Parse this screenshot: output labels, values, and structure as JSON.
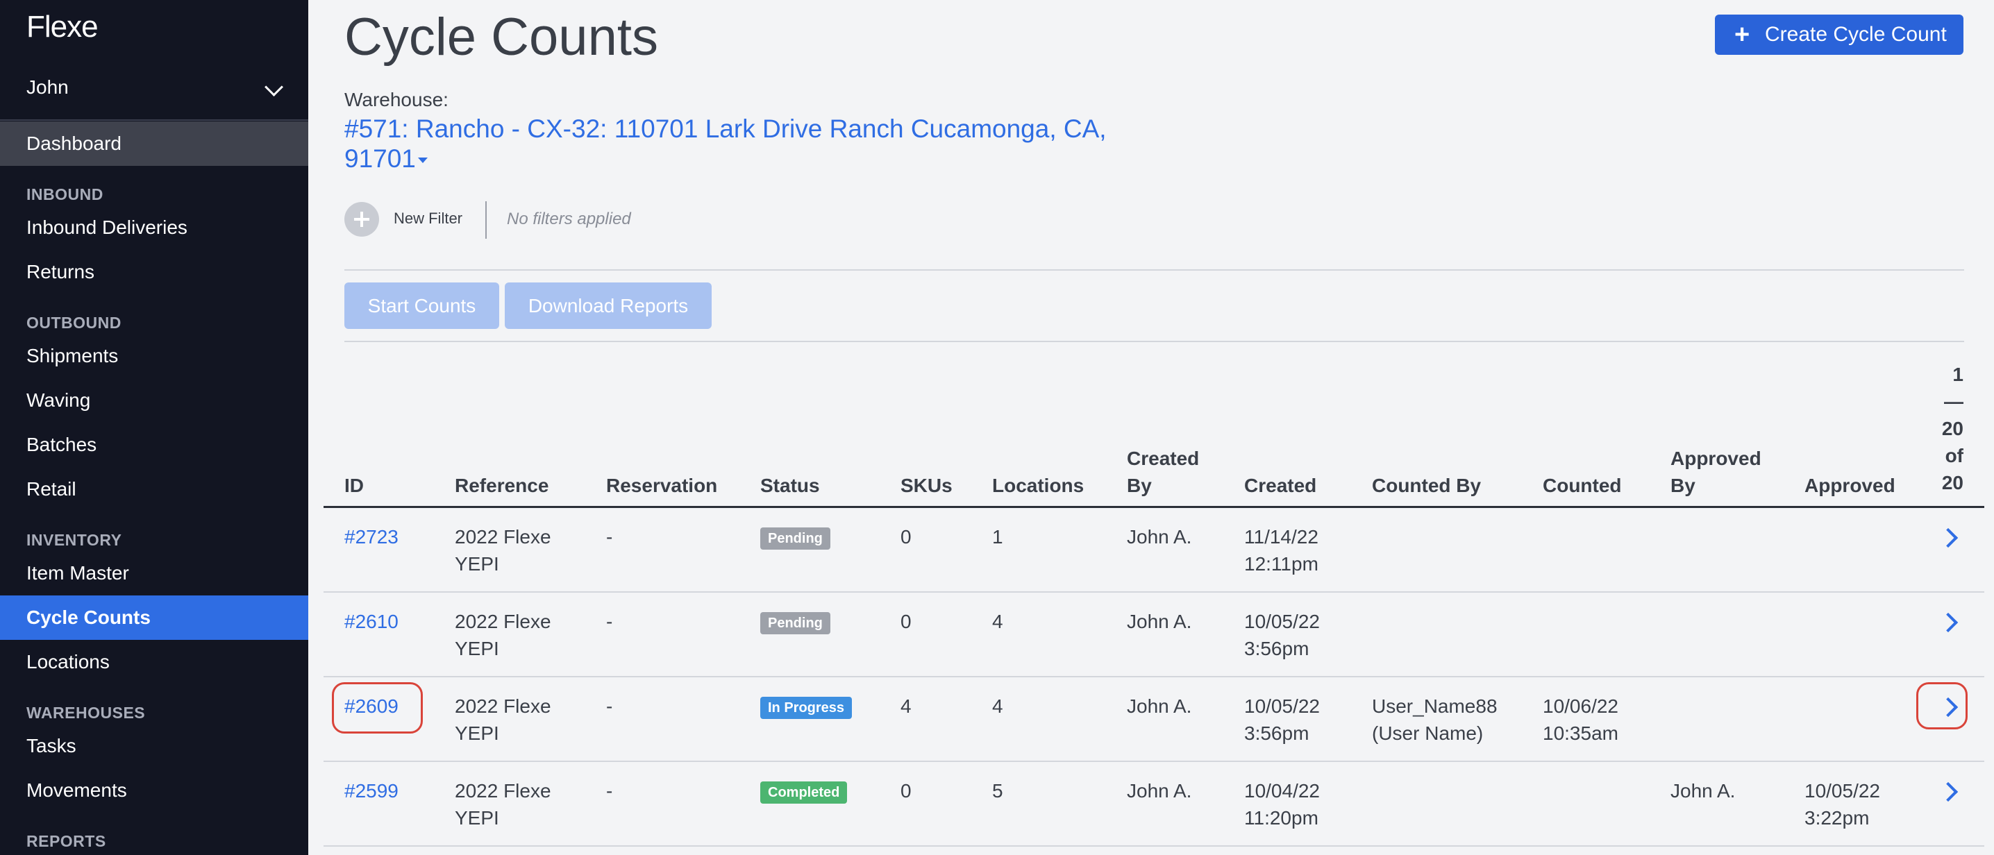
{
  "app": {
    "logo": "Flexe",
    "user": "John"
  },
  "sidebar": {
    "dashboard": "Dashboard",
    "sections": [
      {
        "title": "INBOUND",
        "items": [
          "Inbound Deliveries",
          "Returns"
        ]
      },
      {
        "title": "OUTBOUND",
        "items": [
          "Shipments",
          "Waving",
          "Batches",
          "Retail"
        ]
      },
      {
        "title": "INVENTORY",
        "items": [
          "Item Master",
          "Cycle Counts",
          "Locations"
        ]
      },
      {
        "title": "WAREHOUSES",
        "items": [
          "Tasks",
          "Movements"
        ]
      },
      {
        "title": "REPORTS",
        "items": []
      }
    ],
    "active_item": "Cycle Counts"
  },
  "page": {
    "title": "Cycle Counts",
    "create_button": "Create Cycle Count",
    "warehouse_label": "Warehouse:",
    "warehouse_value": "#571: Rancho - CX-32: 110701 Lark Drive Ranch Cucamonga, CA, 91701",
    "new_filter": "New Filter",
    "no_filters": "No filters applied",
    "start_counts": "Start Counts",
    "download_reports": "Download Reports"
  },
  "table": {
    "headers": {
      "id": "ID",
      "reference": "Reference",
      "reservation": "Reservation",
      "status": "Status",
      "skus": "SKUs",
      "locations": "Locations",
      "created_by_1": "Created",
      "created_by_2": "By",
      "created": "Created",
      "counted_by": "Counted By",
      "counted": "Counted",
      "approved_by_1": "Approved",
      "approved_by_2": "By",
      "approved": "Approved"
    },
    "pagination": {
      "start": "1",
      "dash": "—",
      "end": "20",
      "of": "of",
      "total": "20"
    },
    "rows": [
      {
        "id": "#2723",
        "ref1": "2022 Flexe",
        "ref2": "YEPI",
        "reservation": "-",
        "status": "Pending",
        "skus": "0",
        "locations": "1",
        "created_by": "John A.",
        "created1": "11/14/22",
        "created2": "12:11pm",
        "counted_by1": "",
        "counted_by2": "",
        "counted1": "",
        "counted2": "",
        "approved_by": "",
        "approved1": "",
        "approved2": ""
      },
      {
        "id": "#2610",
        "ref1": "2022 Flexe",
        "ref2": "YEPI",
        "reservation": "-",
        "status": "Pending",
        "skus": "0",
        "locations": "4",
        "created_by": "John A.",
        "created1": "10/05/22",
        "created2": "3:56pm",
        "counted_by1": "",
        "counted_by2": "",
        "counted1": "",
        "counted2": "",
        "approved_by": "",
        "approved1": "",
        "approved2": ""
      },
      {
        "id": "#2609",
        "ref1": "2022 Flexe",
        "ref2": "YEPI",
        "reservation": "-",
        "status": "In Progress",
        "skus": "4",
        "locations": "4",
        "created_by": "John A.",
        "created1": "10/05/22",
        "created2": "3:56pm",
        "counted_by1": "User_Name88",
        "counted_by2": "(User Name)",
        "counted1": "10/06/22",
        "counted2": "10:35am",
        "approved_by": "",
        "approved1": "",
        "approved2": ""
      },
      {
        "id": "#2599",
        "ref1": "2022 Flexe",
        "ref2": "YEPI",
        "reservation": "-",
        "status": "Completed",
        "skus": "0",
        "locations": "5",
        "created_by": "John A.",
        "created1": "10/04/22",
        "created2": "11:20pm",
        "counted_by1": "",
        "counted_by2": "",
        "counted1": "",
        "counted2": "",
        "approved_by": "John A.",
        "approved1": "10/05/22",
        "approved2": "3:22pm"
      }
    ]
  },
  "colors": {
    "accent": "#2a63d9",
    "sidebar_bg": "#121522",
    "pending": "#9da1a9",
    "in_progress": "#3d8fe0",
    "completed": "#4cb570",
    "highlight": "#d9443a"
  }
}
